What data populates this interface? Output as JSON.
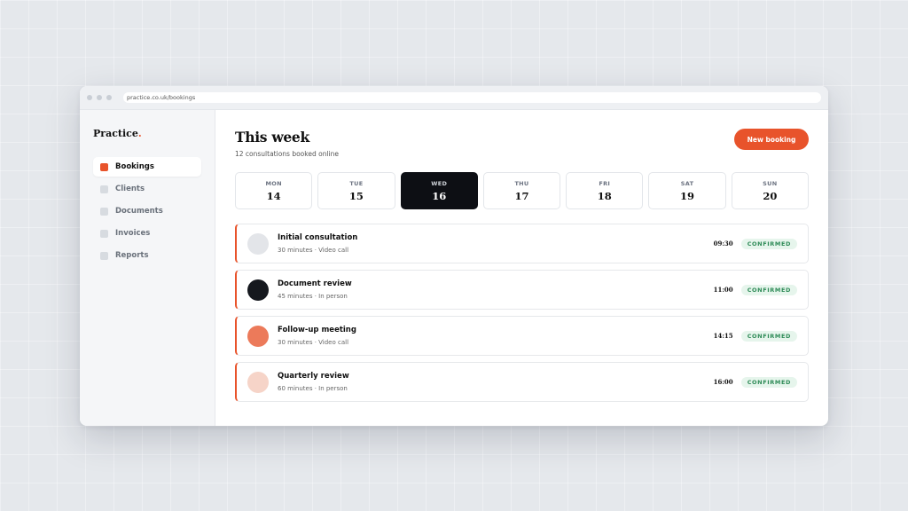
{
  "browser": {
    "url": "practice.co.uk/bookings"
  },
  "sidebar": {
    "logo": "Practice",
    "logo_dot": ".",
    "items": [
      {
        "label": "Bookings",
        "active": true
      },
      {
        "label": "Clients",
        "active": false
      },
      {
        "label": "Documents",
        "active": false
      },
      {
        "label": "Invoices",
        "active": false
      },
      {
        "label": "Reports",
        "active": false
      }
    ]
  },
  "header": {
    "title": "This week",
    "subtitle": "12 consultations booked online",
    "new_booking_label": "New booking"
  },
  "days": [
    {
      "name": "MON",
      "num": "14"
    },
    {
      "name": "TUE",
      "num": "15"
    },
    {
      "name": "WED",
      "num": "16",
      "active": true
    },
    {
      "name": "THU",
      "num": "17"
    },
    {
      "name": "FRI",
      "num": "18"
    },
    {
      "name": "SAT",
      "num": "19"
    },
    {
      "name": "SUN",
      "num": "20"
    }
  ],
  "bookings": [
    {
      "title": "Initial consultation",
      "meta": "30 minutes · Video call",
      "time": "09:30",
      "status": "CONFIRMED",
      "avatar_color": "#e3e5e9"
    },
    {
      "title": "Document review",
      "meta": "45 minutes · In person",
      "time": "11:00",
      "status": "CONFIRMED",
      "avatar_color": "#15181e"
    },
    {
      "title": "Follow-up meeting",
      "meta": "30 minutes · Video call",
      "time": "14:15",
      "status": "CONFIRMED",
      "avatar_color": "#ec7a5a"
    },
    {
      "title": "Quarterly review",
      "meta": "60 minutes · In person",
      "time": "16:00",
      "status": "CONFIRMED",
      "avatar_color": "#f6d4c8"
    }
  ],
  "colors": {
    "accent": "#e8532b",
    "status_green": "#2e8b57"
  }
}
